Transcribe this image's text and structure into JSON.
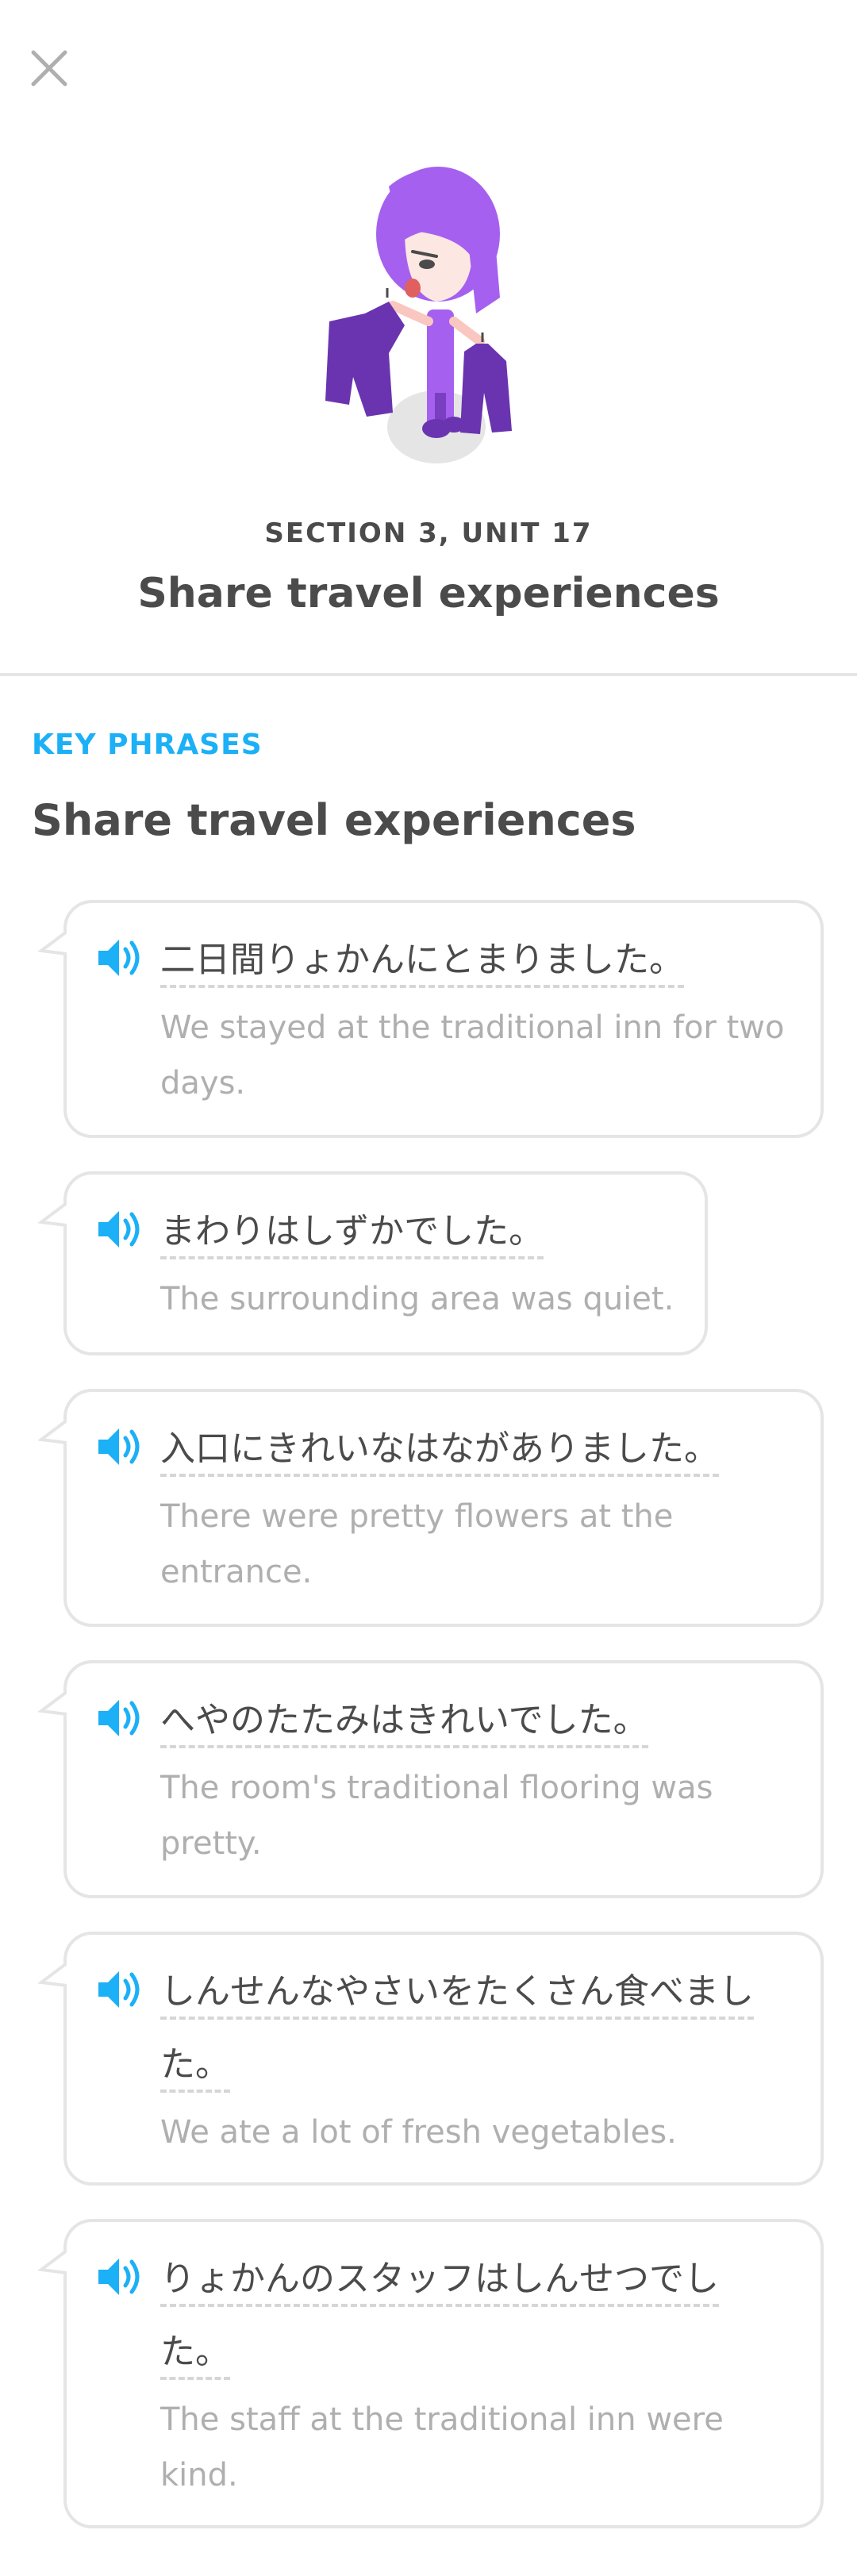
{
  "header": {
    "section_label": "SECTION 3, UNIT 17",
    "unit_title": "Share travel experiences",
    "close_icon": "close-icon"
  },
  "key_phrases": {
    "label": "KEY PHRASES",
    "heading": "Share travel experiences",
    "phrases": [
      {
        "jp_line1": "二日間りょかんにとまりました。",
        "jp_line2": "",
        "en_line1": "We stayed at the traditional inn for two",
        "en_line2": "days."
      },
      {
        "jp_line1": "まわりはしずかでした。",
        "jp_line2": "",
        "en_line1": "The surrounding area was quiet.",
        "en_line2": ""
      },
      {
        "jp_line1": "入口にきれいなはながありました。",
        "jp_line2": "",
        "en_line1": "There were pretty flowers at the",
        "en_line2": "entrance."
      },
      {
        "jp_line1": "へやのたたみはきれいでした。",
        "jp_line2": "",
        "en_line1": "The room's traditional flooring was",
        "en_line2": "pretty."
      },
      {
        "jp_line1": "しんせんなやさいをたくさん食べまし",
        "jp_line2": "た。",
        "en_line1": "We ate a lot of fresh vegetables.",
        "en_line2": ""
      },
      {
        "jp_line1": "りょかんのスタッフはしんせつでし",
        "jp_line2": "た。",
        "en_line1": "The staff at the traditional inn were",
        "en_line2": "kind."
      }
    ]
  },
  "colors": {
    "accent": "#1cb0f6",
    "text": "#4b4b4b",
    "muted": "#afafaf",
    "border": "#e5e5e5",
    "mascot_hair": "#a560f0",
    "mascot_clothes": "#7a3fc0"
  }
}
